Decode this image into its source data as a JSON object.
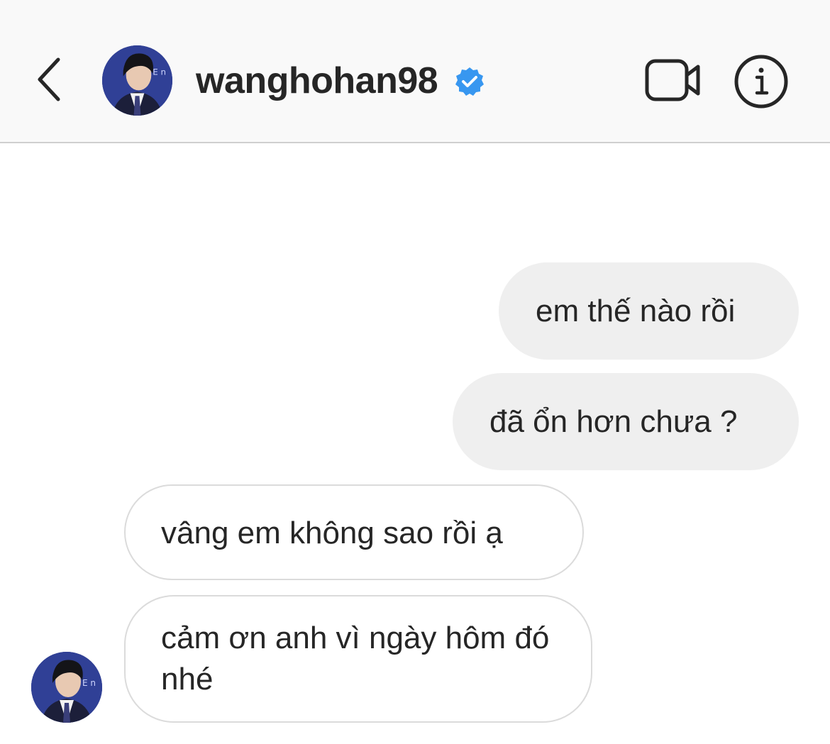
{
  "header": {
    "username": "wanghohan98",
    "verified": true,
    "back_icon": "chevron-left-icon",
    "video_icon": "video-camera-icon",
    "info_icon": "info-icon",
    "verified_color": "#3897f0"
  },
  "messages": [
    {
      "direction": "sent",
      "text": "em thế nào rồi"
    },
    {
      "direction": "sent",
      "text": "đã ổn hơn chưa ?"
    },
    {
      "direction": "received",
      "text": "vâng em không sao rồi ạ"
    },
    {
      "direction": "received",
      "text": "cảm ơn anh vì ngày hôm đó nhé"
    }
  ],
  "colors": {
    "header_bg": "#f9f9f9",
    "sent_bubble": "#efefef",
    "received_border": "#dbdbdb",
    "text": "#262626"
  }
}
